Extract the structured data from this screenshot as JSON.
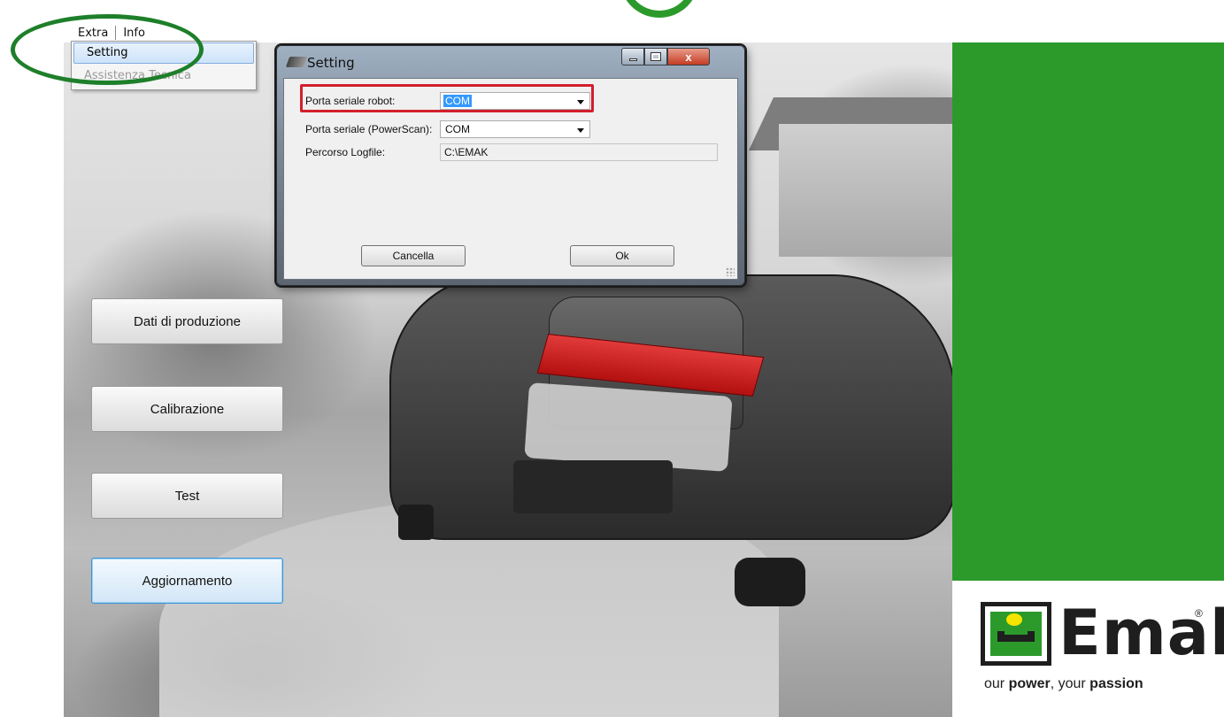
{
  "menu": {
    "items": [
      "Extra",
      "Info"
    ],
    "extra_dropdown": [
      {
        "label": "Setting",
        "state": "hover"
      },
      {
        "label": "Assistenza Tecnica",
        "state": "disabled"
      }
    ]
  },
  "main_buttons": [
    {
      "label": "Dati di produzione"
    },
    {
      "label": "Calibrazione"
    },
    {
      "label": "Test"
    },
    {
      "label": "Aggiornamento"
    }
  ],
  "dialog": {
    "title": "Setting",
    "fields": [
      {
        "label": "Porta seriale robot:",
        "value": "COM",
        "type": "combo"
      },
      {
        "label": "Porta seriale (PowerScan):",
        "value": "COM",
        "type": "combo"
      },
      {
        "label": "Percorso Logfile:",
        "value": "C:\\EMAK",
        "type": "textbox"
      }
    ],
    "cancel_label": "Cancella",
    "ok_label": "Ok",
    "close_glyph": "x"
  },
  "brand": {
    "name": "Emak",
    "registered": "®",
    "tagline_pre": "our ",
    "tagline_b1": "power",
    "tagline_mid": ", your ",
    "tagline_b2": "passion",
    "green": "#2b9a2b",
    "yellow": "#f4e400"
  },
  "annotations": {
    "highlight_color": "#d21f2c",
    "ellipse_color": "#1e7f2a"
  }
}
